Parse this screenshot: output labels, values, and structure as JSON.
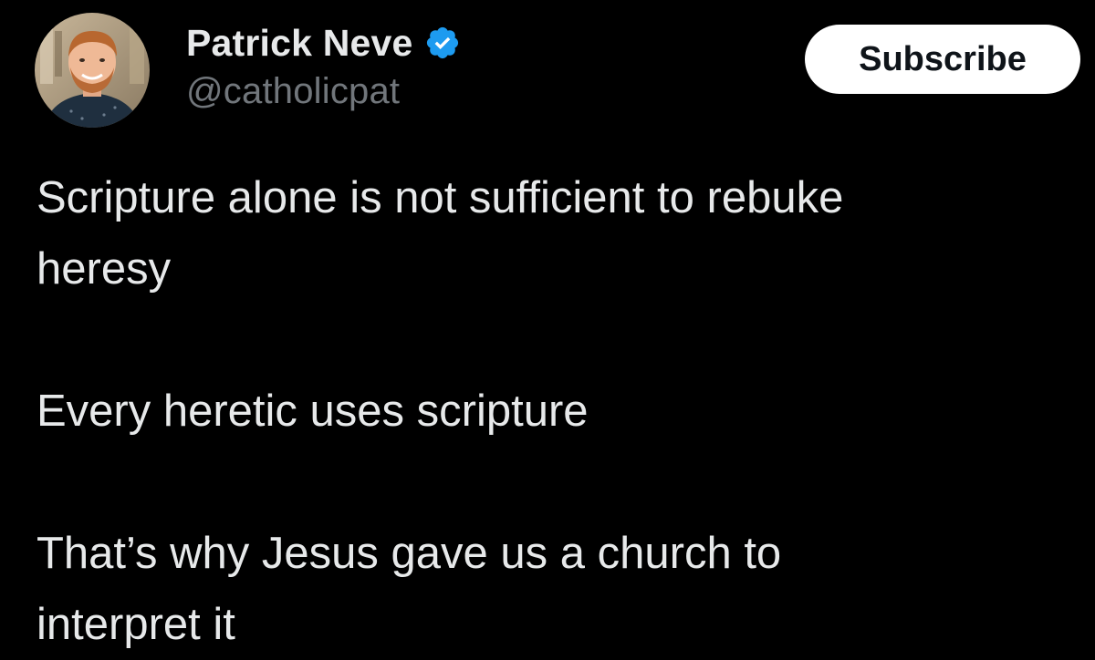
{
  "author": {
    "display_name": "Patrick Neve",
    "handle": "@catholicpat",
    "verified": true
  },
  "actions": {
    "subscribe_label": "Subscribe"
  },
  "tweet": {
    "paragraphs": [
      "Scripture alone is not sufficient to rebuke\nheresy",
      "Every heretic uses scripture",
      "That’s why Jesus gave us a church to\ninterpret it"
    ]
  },
  "icons": {
    "verified": "verified-badge-icon",
    "avatar": "profile-photo"
  },
  "colors": {
    "background": "#000000",
    "text_primary": "#e7e9ea",
    "text_secondary": "#71767b",
    "verified_blue": "#1d9bf0",
    "button_bg": "#ffffff",
    "button_text": "#0f1419"
  }
}
